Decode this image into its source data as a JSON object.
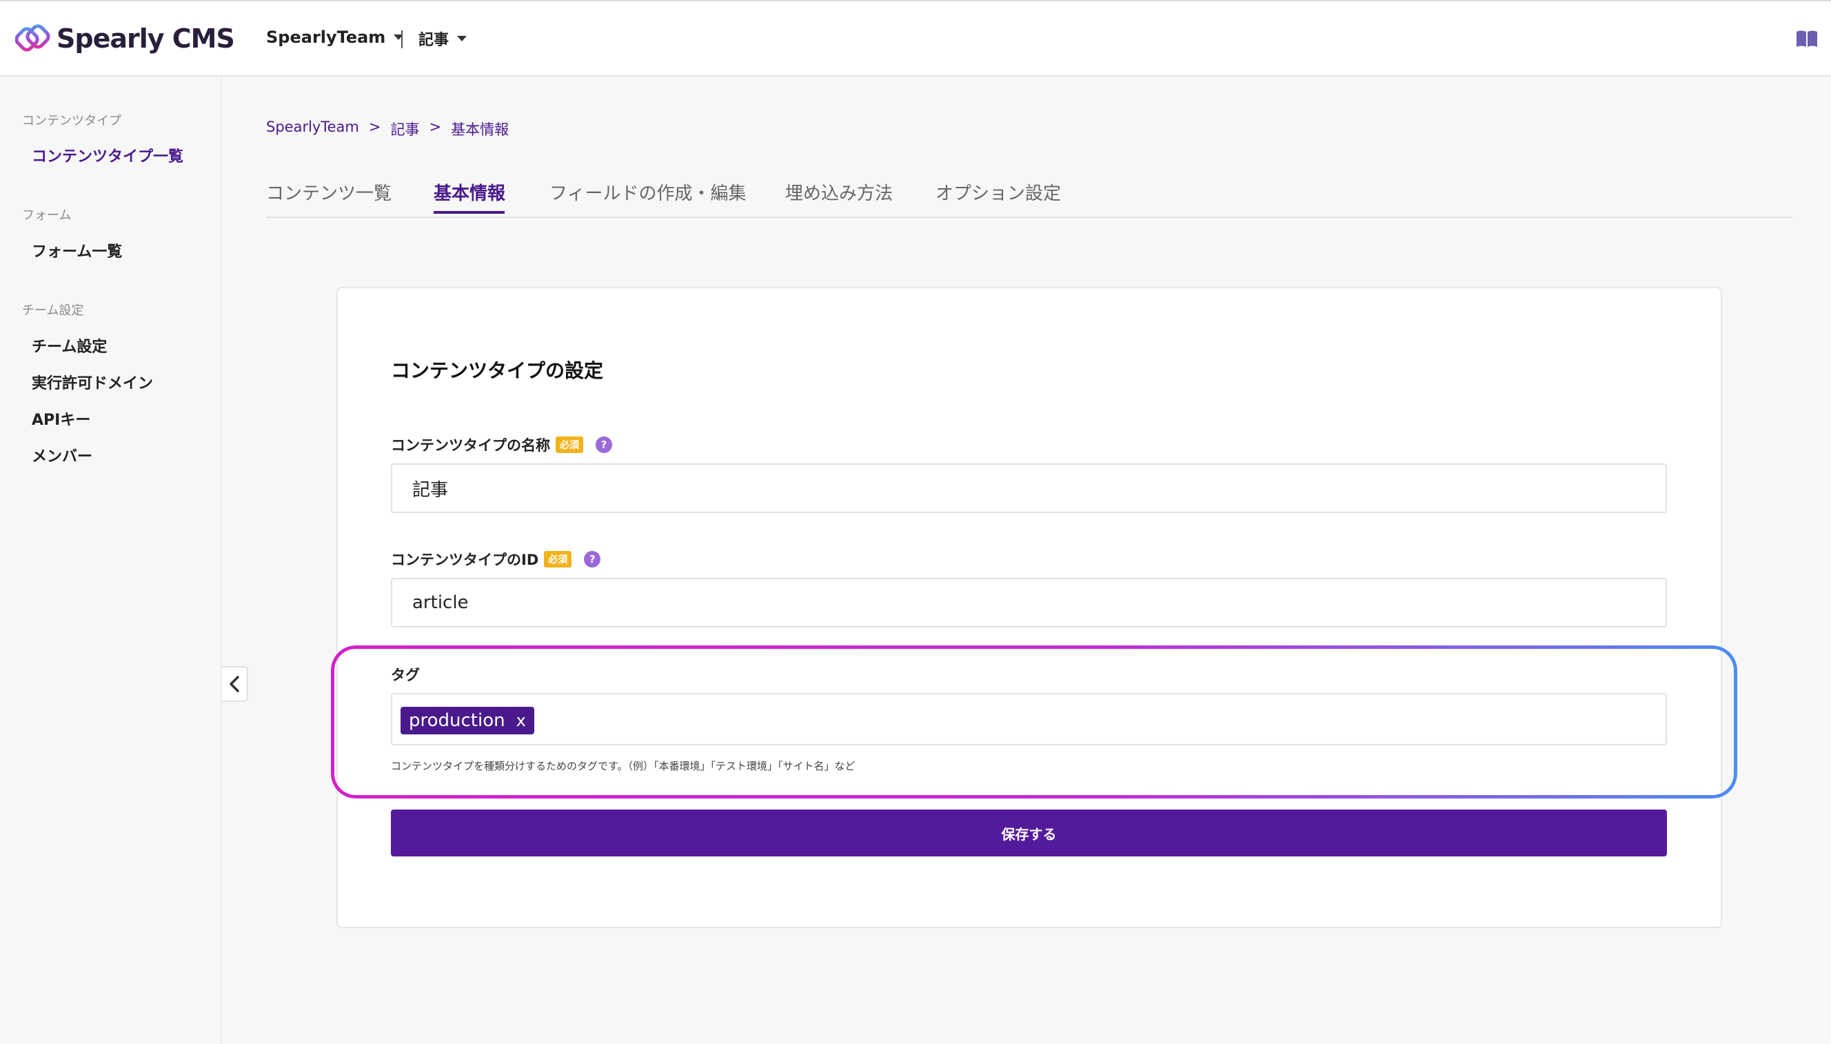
{
  "header": {
    "logo_text": "Spearly CMS",
    "team": "SpearlyTeam",
    "content_type": "記事"
  },
  "sidebar": {
    "sections": [
      {
        "title": "コンテンツタイプ",
        "items": [
          {
            "label": "コンテンツタイプ一覧",
            "active": true
          }
        ]
      },
      {
        "title": "フォーム",
        "items": [
          {
            "label": "フォーム一覧"
          }
        ]
      },
      {
        "title": "チーム設定",
        "items": [
          {
            "label": "チーム設定"
          },
          {
            "label": "実行許可ドメイン"
          },
          {
            "label": "APIキー"
          },
          {
            "label": "メンバー"
          }
        ]
      }
    ]
  },
  "breadcrumb": [
    "SpearlyTeam",
    "記事",
    "基本情報"
  ],
  "breadcrumb_sep": ">",
  "tabs": [
    {
      "label": "コンテンツ一覧"
    },
    {
      "label": "基本情報",
      "active": true
    },
    {
      "label": "フィールドの作成・編集"
    },
    {
      "label": "埋め込み方法"
    },
    {
      "label": "オプション設定"
    }
  ],
  "form": {
    "title": "コンテンツタイプの設定",
    "name_label": "コンテンツタイプの名称",
    "name_value": "記事",
    "id_label": "コンテンツタイプのID",
    "id_value": "article",
    "required_badge": "必須",
    "help_glyph": "?",
    "tag_label": "タグ",
    "tags": [
      "production"
    ],
    "tag_remove": "x",
    "tag_hint": "コンテンツタイプを種類分けするためのタグです。（例）「本番環境」「テスト環境」「サイト名」など",
    "save_label": "保存する"
  },
  "colors": {
    "accent": "#4a1a8c",
    "button": "#541a9c",
    "required": "#f2b21c",
    "help": "#9b6ad8"
  },
  "icons": {
    "logo": "spearly-logo-icon",
    "docs": "book-icon",
    "collapse": "chevron-left-icon"
  }
}
